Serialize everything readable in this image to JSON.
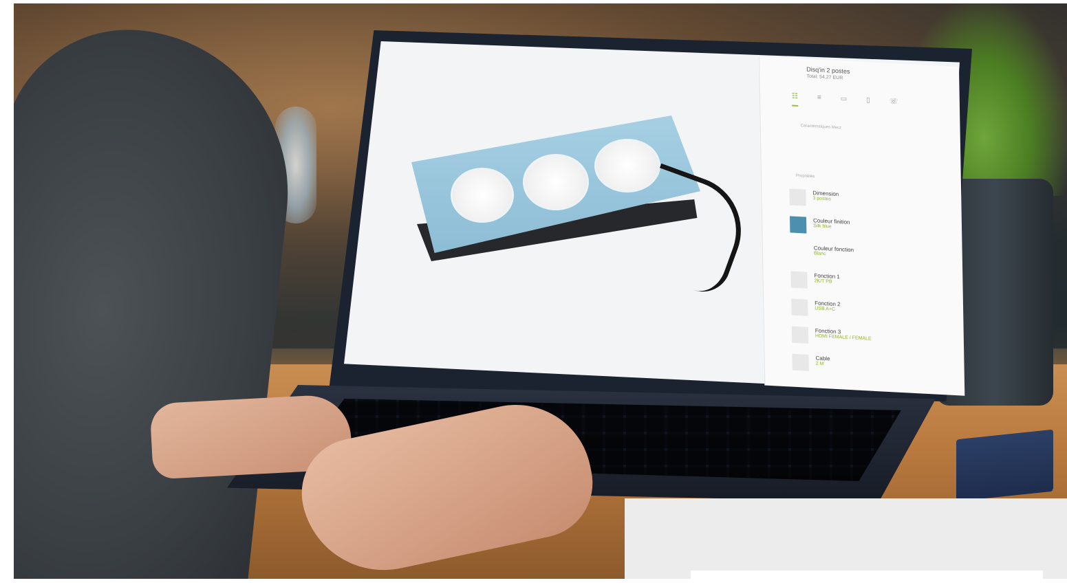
{
  "configurator": {
    "product_title": "Disq'in 2 postes",
    "total": "Total: 54,27 EUR",
    "tab_icons": [
      "sliders-icon",
      "list-icon",
      "image-icon",
      "document-icon",
      "phone-icon"
    ],
    "section_characteristics": "Caractéristiques Mecz",
    "section_properties": "Propriétés",
    "properties": [
      {
        "label": "Dimension",
        "value": "3 postes",
        "swatch": "#e8e8e8"
      },
      {
        "label": "Couleur finition",
        "value": "Silk blue",
        "swatch": "#4c8fae"
      },
      {
        "label": "Couleur fonction",
        "value": "Blanc",
        "swatch": "#fafafa"
      },
      {
        "label": "Fonction 1",
        "value": "2K/T PB",
        "swatch": "#e8e8e8"
      },
      {
        "label": "Fonction 2",
        "value": "USB A+C",
        "swatch": "#e8e8e8"
      },
      {
        "label": "Fonction 3",
        "value": "HDMI FEMALE / FEMALE",
        "swatch": "#e8e8e8"
      },
      {
        "label": "Cable",
        "value": "2 M",
        "swatch": "#e8e8e8"
      }
    ],
    "accent_color": "#8fb62a"
  }
}
